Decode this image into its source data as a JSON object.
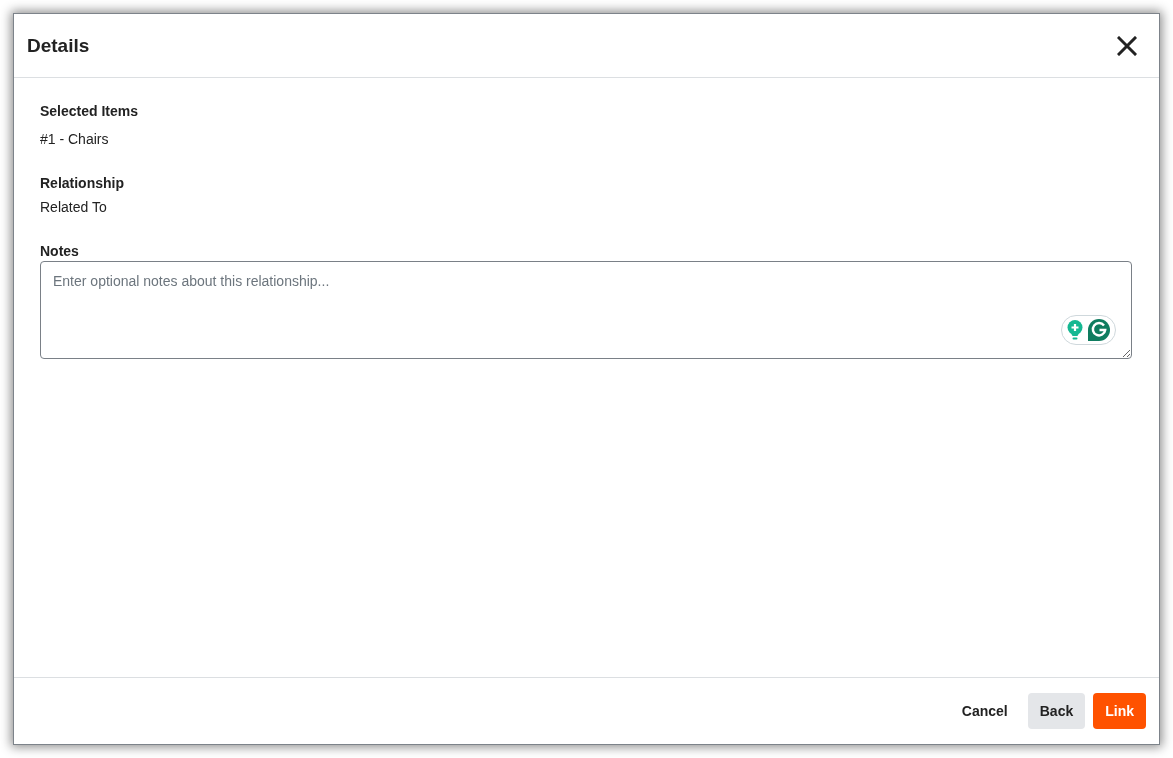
{
  "dialog": {
    "title": "Details"
  },
  "fields": [
    {
      "kind": "list",
      "label": "Selected Items",
      "items": [
        "#1 - Chairs"
      ]
    },
    {
      "kind": "readonly",
      "label": "Relationship",
      "value": "Related To"
    },
    {
      "kind": "textarea",
      "label": "Notes",
      "placeholder": "Enter optional notes about this relationship..."
    }
  ],
  "buttons": [
    {
      "kind": "text",
      "label": "Cancel"
    },
    {
      "kind": "secondary",
      "label": "Back"
    },
    {
      "kind": "primary",
      "label": "Link"
    }
  ]
}
